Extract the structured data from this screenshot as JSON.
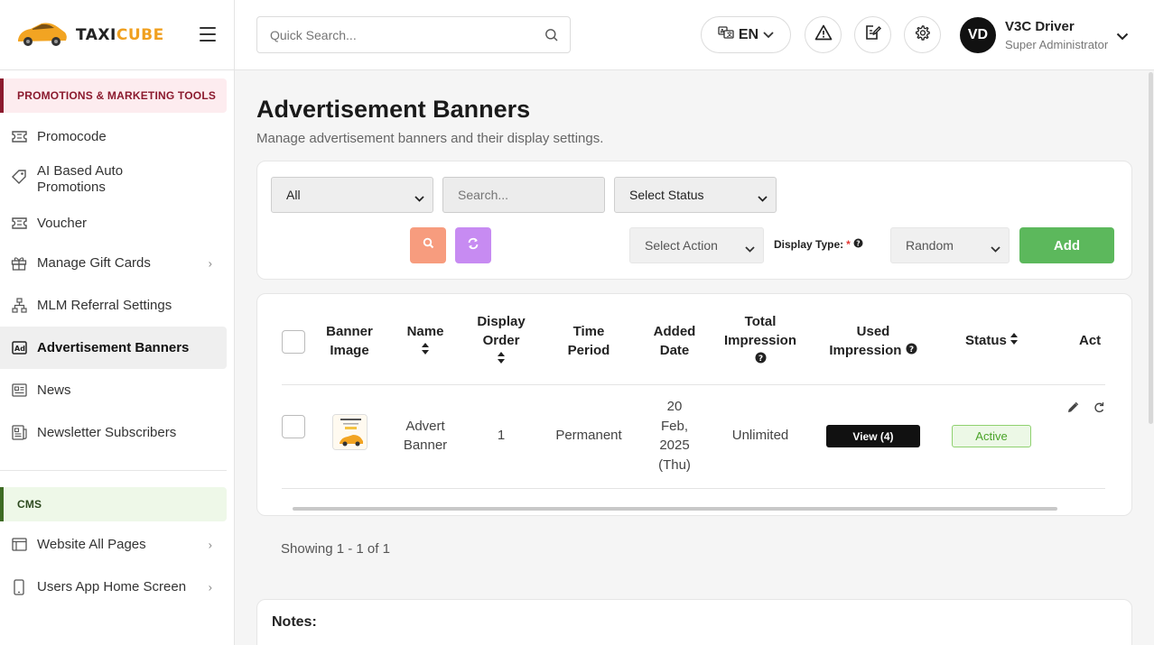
{
  "brand": {
    "name_part1": "TAXI",
    "name_part2": "CUBE"
  },
  "sidebar": {
    "sections": [
      {
        "title": "PROMOTIONS & MARKETING TOOLS",
        "items": [
          {
            "label": "Promocode",
            "icon": "ticket-icon"
          },
          {
            "label": "AI Based Auto Promotions",
            "icon": "tag-icon"
          },
          {
            "label": "Voucher",
            "icon": "ticket-icon"
          },
          {
            "label": "Manage Gift Cards",
            "icon": "gift-icon",
            "has_submenu": true
          },
          {
            "label": "MLM Referral Settings",
            "icon": "network-icon"
          },
          {
            "label": "Advertisement Banners",
            "icon": "ad-icon",
            "active": true
          },
          {
            "label": "News",
            "icon": "news-icon"
          },
          {
            "label": "Newsletter Subscribers",
            "icon": "newsletter-icon"
          }
        ]
      },
      {
        "title": "CMS",
        "items": [
          {
            "label": "Website All Pages",
            "icon": "browser-icon",
            "has_submenu": true
          },
          {
            "label": "Users App Home Screen",
            "icon": "mobile-icon",
            "has_submenu": true
          }
        ]
      }
    ]
  },
  "header": {
    "search_placeholder": "Quick Search...",
    "language": "EN",
    "user": {
      "initials": "VD",
      "name": "V3C Driver",
      "role": "Super Administrator"
    }
  },
  "page": {
    "title": "Advertisement Banners",
    "subtitle": "Manage advertisement banners and their display settings."
  },
  "filters": {
    "scope_value": "All",
    "search_placeholder": "Search...",
    "status_value": "Select Status",
    "action_value": "Select Action",
    "display_type_label": "Display Type:",
    "display_type_required": "*",
    "display_type_value": "Random",
    "add_label": "Add",
    "colors": {
      "search_btn": "#f79c7e",
      "reset_btn": "#c78bf2",
      "add_btn": "#5cb85c"
    }
  },
  "table": {
    "headers": {
      "banner_image": [
        "Banner",
        "Image"
      ],
      "name": "Name",
      "display_order": [
        "Display",
        "Order"
      ],
      "time_period": [
        "Time",
        "Period"
      ],
      "added_date": [
        "Added",
        "Date"
      ],
      "total_impression": [
        "Total",
        "Impression"
      ],
      "used_impression": [
        "Used",
        "Impression"
      ],
      "status": "Status",
      "action": "Act"
    },
    "rows": [
      {
        "name": [
          "Advert",
          "Banner"
        ],
        "display_order": "1",
        "time_period": "Permanent",
        "added_date": [
          "20",
          "Feb,",
          "2025",
          "(Thu)"
        ],
        "total_impression": "Unlimited",
        "used_impression_btn": "View (4)",
        "status": "Active"
      }
    ]
  },
  "pagination": {
    "showing": "Showing 1 - 1 of 1"
  },
  "notes": {
    "title": "Notes:"
  }
}
